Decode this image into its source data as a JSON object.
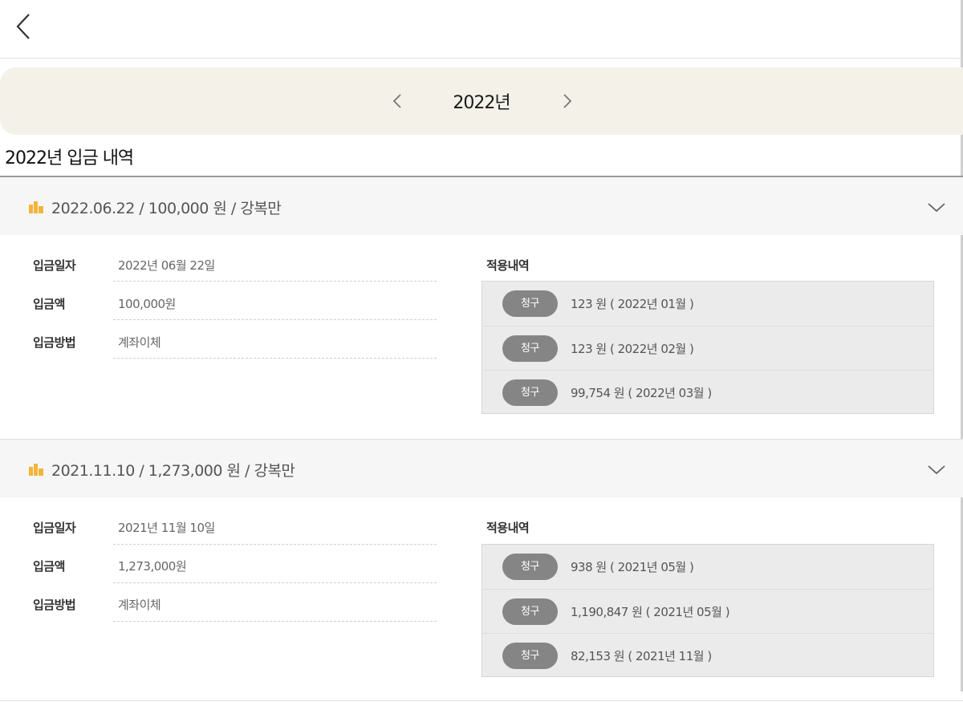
{
  "nav": {
    "back_icon": "chevron-left-icon"
  },
  "year_selector": {
    "year": "2022년",
    "prev_icon": "chevron-left-icon",
    "next_icon": "chevron-right-icon"
  },
  "section_title": "2022년 입금 내역",
  "colors": {
    "year_bar": "#f3f1e8",
    "badge": "#858585",
    "icon_accent": "#f2b43a",
    "header_bg": "#f6f6f6"
  },
  "deposits": [
    {
      "summary": "2022.06.22 / 100,000 원 / 강복만",
      "icon": "money-icon",
      "details": [
        {
          "label": "입금일자",
          "value": "2022년 06월 22일"
        },
        {
          "label": "입금액",
          "value": "100,000원"
        },
        {
          "label": "입금방법",
          "value": "계좌이체"
        }
      ],
      "apply_title": "적용내역",
      "applications": [
        {
          "badge": "청구",
          "text": "123 원 ( 2022년 01월 )"
        },
        {
          "badge": "청구",
          "text": "123 원 ( 2022년 02월 )"
        },
        {
          "badge": "청구",
          "text": "99,754 원 ( 2022년 03월 )"
        }
      ]
    },
    {
      "summary": "2021.11.10 / 1,273,000 원 / 강복만",
      "icon": "money-icon",
      "details": [
        {
          "label": "입금일자",
          "value": "2021년 11월 10일"
        },
        {
          "label": "입금액",
          "value": "1,273,000원"
        },
        {
          "label": "입금방법",
          "value": "계좌이체"
        }
      ],
      "apply_title": "적용내역",
      "applications": [
        {
          "badge": "청구",
          "text": "938 원 ( 2021년 05월 )"
        },
        {
          "badge": "청구",
          "text": "1,190,847 원 ( 2021년 05월 )"
        },
        {
          "badge": "청구",
          "text": "82,153 원 ( 2021년 11월 )"
        }
      ]
    }
  ]
}
